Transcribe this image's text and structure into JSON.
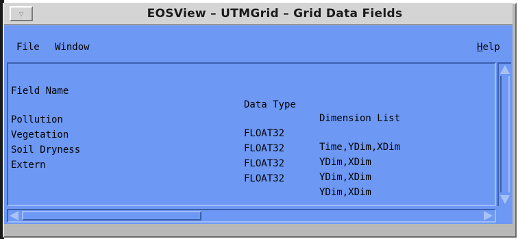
{
  "window": {
    "title": "EOSView – UTMGrid – Grid Data Fields",
    "menu_button_glyph": "▽"
  },
  "menubar": {
    "file": "File",
    "window": "Window",
    "help_mnemonic": "H",
    "help_rest": "elp"
  },
  "list": {
    "headers": {
      "name": "Field Name",
      "type": "Data Type",
      "dims": "Dimension List"
    },
    "rows": [
      {
        "name": "Pollution",
        "type": "FLOAT32",
        "dims": "Time,YDim,XDim"
      },
      {
        "name": "Vegetation",
        "type": "FLOAT32",
        "dims": "YDim,XDim"
      },
      {
        "name": "Soil Dryness",
        "type": "FLOAT32",
        "dims": "YDim,XDim"
      },
      {
        "name": "Extern",
        "type": "FLOAT32",
        "dims": "YDim,XDim"
      }
    ]
  },
  "colors": {
    "client": "#6d98f4",
    "titlebar": "#d4d4d4"
  },
  "icons": {
    "scroll_up": "scroll-up-arrow-icon",
    "scroll_down": "scroll-down-arrow-icon",
    "scroll_left": "scroll-left-arrow-icon",
    "scroll_right": "scroll-right-arrow-icon"
  }
}
